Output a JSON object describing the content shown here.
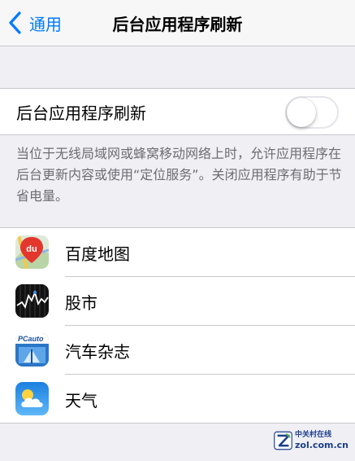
{
  "nav": {
    "back_label": "通用",
    "title": "后台应用程序刷新"
  },
  "main_toggle": {
    "label": "后台应用程序刷新",
    "state": "off"
  },
  "description": "当位于无线局域网或蜂窝移动网络上时，允许应用程序在后台更新内容或使用“定位服务”。关闭应用程序有助于节省电量。",
  "apps": [
    {
      "name": "百度地图",
      "icon": "baidu-map-icon",
      "icon_text": "du"
    },
    {
      "name": "股市",
      "icon": "stocks-icon"
    },
    {
      "name": "汽车杂志",
      "icon": "pcauto-icon",
      "icon_text": "PCauto"
    },
    {
      "name": "天气",
      "icon": "weather-icon"
    }
  ],
  "watermark": {
    "cn": "中关村在线",
    "en": "zol.com.cn"
  },
  "colors": {
    "accent": "#007aff",
    "background": "#efeff4",
    "separator": "#c8c7cc",
    "footnote": "#6d6d72"
  }
}
